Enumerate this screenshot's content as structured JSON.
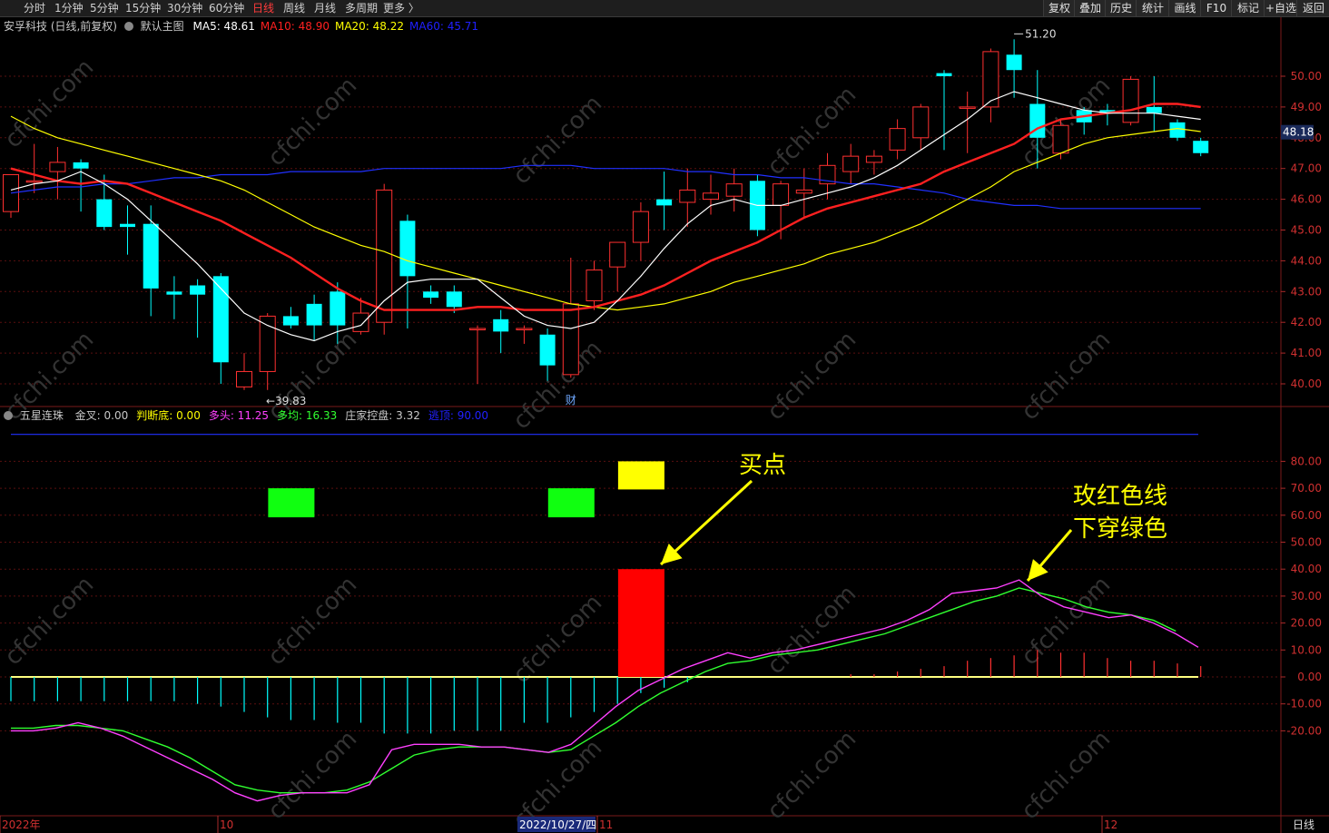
{
  "toolbar": {
    "periods": [
      {
        "label": "分时",
        "active": false
      },
      {
        "label": "1分钟",
        "active": false
      },
      {
        "label": "5分钟",
        "active": false
      },
      {
        "label": "15分钟",
        "active": false
      },
      {
        "label": "30分钟",
        "active": false
      },
      {
        "label": "60分钟",
        "active": false
      },
      {
        "label": "日线",
        "active": true
      },
      {
        "label": "周线",
        "active": false
      },
      {
        "label": "月线",
        "active": false
      },
      {
        "label": "多周期",
        "active": false
      },
      {
        "label": "更多 〉",
        "active": false
      }
    ],
    "right_buttons": [
      "复权",
      "叠加",
      "历史",
      "统计",
      "画线",
      "F10",
      "标记",
      "+自选",
      "返回"
    ]
  },
  "main_panel": {
    "stock_label": "安孚科技 (日线,前复权)",
    "indicator_name": "默认主图",
    "ma": [
      {
        "label": "MA5: 48.61",
        "color": "#ffffff"
      },
      {
        "label": "MA10: 48.90",
        "color": "#ff2020"
      },
      {
        "label": "MA20: 48.22",
        "color": "#ffff00"
      },
      {
        "label": "MA60: 45.71",
        "color": "#2020ff"
      }
    ],
    "high_label": "51.20",
    "low_label": "39.83",
    "current_price": "48.18",
    "event_marker": "财",
    "y_ticks": [
      "50.00",
      "49.00",
      "48.00",
      "47.00",
      "46.00",
      "45.00",
      "44.00",
      "43.00",
      "42.00",
      "41.00",
      "40.00"
    ]
  },
  "sub_panel": {
    "indicator_name": "五星连珠",
    "values": [
      {
        "label": "金叉: 0.00",
        "color": "#c8c8c8"
      },
      {
        "label": "判断底: 0.00",
        "color": "#ffff00"
      },
      {
        "label": "多头: 11.25",
        "color": "#ff40ff"
      },
      {
        "label": "多均: 16.33",
        "color": "#30ff30"
      },
      {
        "label": "庄家控盘: 3.32",
        "color": "#c8c8c8"
      },
      {
        "label": "逃顶: 90.00",
        "color": "#2020ff"
      }
    ],
    "y_ticks": [
      "80.00",
      "70.00",
      "60.00",
      "50.00",
      "40.00",
      "30.00",
      "20.00",
      "10.00",
      "0.00",
      "-10.00",
      "-20.00"
    ]
  },
  "bottom_axis": {
    "labels": [
      "2022年",
      "10",
      "11",
      "12"
    ],
    "cursor_date": "2022/10/27/四",
    "period_label": "日线"
  },
  "annotations": {
    "buy_point": "买点",
    "cross_line1": "玫红色线",
    "cross_line2": "下穿绿色"
  },
  "colors": {
    "up": "#ff3030",
    "down": "#00ffff",
    "ma5": "#ffffff",
    "ma10": "#ff2020",
    "ma20": "#ffff00",
    "ma60": "#2030ff",
    "duotou": "#ff40ff",
    "duojun": "#30ff30",
    "annotation": "#ffff00",
    "watermark": "cfchi.com"
  },
  "chart_data": {
    "type": "candlestick",
    "candles": [
      {
        "o": 45.6,
        "h": 46.8,
        "l": 45.4,
        "c": 46.8
      },
      {
        "o": 46.6,
        "h": 47.8,
        "l": 46.2,
        "c": 46.6
      },
      {
        "o": 46.9,
        "h": 47.7,
        "l": 46.0,
        "c": 47.2
      },
      {
        "o": 47.2,
        "h": 47.3,
        "l": 45.6,
        "c": 47.0
      },
      {
        "o": 46.0,
        "h": 46.8,
        "l": 45.0,
        "c": 45.1
      },
      {
        "o": 45.2,
        "h": 45.8,
        "l": 44.2,
        "c": 45.1
      },
      {
        "o": 45.2,
        "h": 45.8,
        "l": 42.2,
        "c": 43.1
      },
      {
        "o": 43.0,
        "h": 43.5,
        "l": 42.1,
        "c": 42.9
      },
      {
        "o": 43.2,
        "h": 43.4,
        "l": 41.5,
        "c": 42.9
      },
      {
        "o": 43.5,
        "h": 43.6,
        "l": 40.0,
        "c": 40.7
      },
      {
        "o": 39.9,
        "h": 41.0,
        "l": 39.8,
        "c": 40.4
      },
      {
        "o": 40.4,
        "h": 42.3,
        "l": 39.8,
        "c": 42.2
      },
      {
        "o": 42.2,
        "h": 42.5,
        "l": 41.8,
        "c": 41.9
      },
      {
        "o": 42.6,
        "h": 42.9,
        "l": 41.4,
        "c": 41.9
      },
      {
        "o": 43.0,
        "h": 43.3,
        "l": 41.3,
        "c": 41.9
      },
      {
        "o": 41.7,
        "h": 42.8,
        "l": 41.6,
        "c": 42.3
      },
      {
        "o": 42.0,
        "h": 46.5,
        "l": 41.6,
        "c": 46.3
      },
      {
        "o": 45.3,
        "h": 45.5,
        "l": 41.8,
        "c": 43.5
      },
      {
        "o": 43.0,
        "h": 43.2,
        "l": 42.6,
        "c": 42.8
      },
      {
        "o": 43.0,
        "h": 43.2,
        "l": 42.3,
        "c": 42.5
      },
      {
        "o": 41.8,
        "h": 41.9,
        "l": 40.0,
        "c": 41.8
      },
      {
        "o": 42.1,
        "h": 42.4,
        "l": 41.0,
        "c": 41.7
      },
      {
        "o": 41.8,
        "h": 41.9,
        "l": 41.3,
        "c": 41.8
      },
      {
        "o": 41.6,
        "h": 41.8,
        "l": 40.1,
        "c": 40.6
      },
      {
        "o": 40.3,
        "h": 44.1,
        "l": 40.2,
        "c": 42.6
      },
      {
        "o": 42.7,
        "h": 44.0,
        "l": 42.4,
        "c": 43.7
      },
      {
        "o": 43.8,
        "h": 44.6,
        "l": 43.0,
        "c": 44.6
      },
      {
        "o": 44.6,
        "h": 45.9,
        "l": 44.0,
        "c": 45.6
      },
      {
        "o": 46.0,
        "h": 46.9,
        "l": 45.0,
        "c": 45.8
      },
      {
        "o": 45.9,
        "h": 47.0,
        "l": 45.1,
        "c": 46.3
      },
      {
        "o": 46.0,
        "h": 46.8,
        "l": 45.5,
        "c": 46.2
      },
      {
        "o": 46.1,
        "h": 47.0,
        "l": 45.6,
        "c": 46.5
      },
      {
        "o": 46.6,
        "h": 46.8,
        "l": 44.8,
        "c": 45.0
      },
      {
        "o": 45.8,
        "h": 46.6,
        "l": 44.7,
        "c": 46.5
      },
      {
        "o": 46.2,
        "h": 47.0,
        "l": 45.4,
        "c": 46.3
      },
      {
        "o": 46.5,
        "h": 47.5,
        "l": 46.0,
        "c": 47.1
      },
      {
        "o": 46.9,
        "h": 47.8,
        "l": 46.5,
        "c": 47.4
      },
      {
        "o": 47.2,
        "h": 47.6,
        "l": 46.8,
        "c": 47.4
      },
      {
        "o": 47.6,
        "h": 48.6,
        "l": 47.3,
        "c": 48.3
      },
      {
        "o": 48.0,
        "h": 49.1,
        "l": 47.6,
        "c": 49.0
      },
      {
        "o": 50.1,
        "h": 50.2,
        "l": 47.6,
        "c": 50.0
      },
      {
        "o": 49.0,
        "h": 49.5,
        "l": 47.5,
        "c": 49.0
      },
      {
        "o": 49.0,
        "h": 50.9,
        "l": 48.5,
        "c": 50.8
      },
      {
        "o": 50.7,
        "h": 51.2,
        "l": 49.3,
        "c": 50.2
      },
      {
        "o": 49.1,
        "h": 50.2,
        "l": 47.0,
        "c": 48.0
      },
      {
        "o": 47.5,
        "h": 48.6,
        "l": 47.3,
        "c": 48.4
      },
      {
        "o": 48.9,
        "h": 49.0,
        "l": 48.1,
        "c": 48.5
      },
      {
        "o": 48.9,
        "h": 49.1,
        "l": 48.4,
        "c": 48.8
      },
      {
        "o": 48.5,
        "h": 50.0,
        "l": 48.4,
        "c": 49.9
      },
      {
        "o": 49.0,
        "h": 50.0,
        "l": 48.2,
        "c": 48.8
      },
      {
        "o": 48.5,
        "h": 48.6,
        "l": 47.9,
        "c": 48.0
      },
      {
        "o": 47.9,
        "h": 48.0,
        "l": 47.4,
        "c": 47.5
      }
    ],
    "ma5": [
      46.3,
      46.5,
      46.6,
      46.9,
      46.5,
      46.0,
      45.3,
      44.6,
      43.9,
      43.1,
      42.3,
      41.9,
      41.6,
      41.4,
      41.7,
      41.9,
      42.7,
      43.3,
      43.4,
      43.4,
      43.4,
      42.8,
      42.2,
      41.9,
      41.8,
      42.0,
      42.7,
      43.5,
      44.4,
      45.2,
      45.8,
      46.0,
      45.8,
      45.8,
      46.0,
      46.2,
      46.4,
      46.7,
      47.1,
      47.6,
      48.1,
      48.6,
      49.2,
      49.5,
      49.3,
      49.1,
      48.9,
      48.8,
      48.8,
      48.8,
      48.7,
      48.6
    ],
    "ma10": [
      47.0,
      46.8,
      46.6,
      46.5,
      46.6,
      46.5,
      46.2,
      45.9,
      45.6,
      45.3,
      44.9,
      44.5,
      44.1,
      43.6,
      43.1,
      42.7,
      42.4,
      42.4,
      42.4,
      42.4,
      42.5,
      42.5,
      42.4,
      42.4,
      42.4,
      42.5,
      42.7,
      42.9,
      43.2,
      43.6,
      44.0,
      44.3,
      44.6,
      45.0,
      45.4,
      45.7,
      45.9,
      46.1,
      46.3,
      46.5,
      46.9,
      47.2,
      47.5,
      47.8,
      48.3,
      48.6,
      48.7,
      48.8,
      48.9,
      49.1,
      49.1,
      49.0
    ],
    "ma20": [
      48.7,
      48.3,
      48.0,
      47.8,
      47.6,
      47.4,
      47.2,
      47.0,
      46.8,
      46.6,
      46.3,
      45.9,
      45.5,
      45.1,
      44.8,
      44.5,
      44.3,
      44.0,
      43.8,
      43.6,
      43.4,
      43.2,
      43.0,
      42.8,
      42.6,
      42.5,
      42.4,
      42.5,
      42.6,
      42.8,
      43.0,
      43.3,
      43.5,
      43.7,
      43.9,
      44.2,
      44.4,
      44.6,
      44.9,
      45.2,
      45.6,
      46.0,
      46.4,
      46.9,
      47.2,
      47.5,
      47.8,
      48.0,
      48.1,
      48.2,
      48.3,
      48.2
    ],
    "ma60": [
      46.2,
      46.3,
      46.4,
      46.4,
      46.5,
      46.5,
      46.6,
      46.7,
      46.7,
      46.8,
      46.8,
      46.8,
      46.9,
      46.9,
      46.9,
      46.9,
      47.0,
      47.0,
      47.0,
      47.0,
      47.0,
      47.0,
      47.1,
      47.1,
      47.1,
      47.0,
      47.0,
      47.0,
      47.0,
      46.9,
      46.9,
      46.8,
      46.8,
      46.7,
      46.7,
      46.6,
      46.5,
      46.5,
      46.4,
      46.3,
      46.2,
      46.0,
      45.9,
      45.8,
      45.8,
      45.7,
      45.7,
      45.7,
      45.7,
      45.7,
      45.7,
      45.7
    ],
    "sub": {
      "green_markers": [
        12,
        24
      ],
      "yellow_marker": 27,
      "red_bar": {
        "index": 27,
        "from": 0,
        "to": 40
      },
      "topline": 90,
      "hist": [
        -9,
        -9,
        -9,
        -9,
        -9,
        -9,
        -9,
        -9,
        -10,
        -11,
        -13,
        -15,
        -16,
        -16,
        -17,
        -17,
        -21,
        -21,
        -21,
        -20,
        -20,
        -20,
        -17,
        -17,
        -15,
        -13,
        -10,
        -6,
        -4,
        -2,
        0,
        0,
        0,
        0,
        0,
        0,
        1,
        1,
        2,
        3,
        4,
        6,
        7,
        8,
        10,
        9,
        9,
        7,
        6,
        6,
        5,
        4
      ],
      "duotou": [
        -20,
        -20,
        -19,
        -17,
        -19,
        -22,
        -26,
        -30,
        -34,
        -38,
        -43,
        -46,
        -44,
        -43,
        -43,
        -43,
        -40,
        -27,
        -25,
        -25,
        -25,
        -26,
        -26,
        -27,
        -28,
        -25,
        -18,
        -11,
        -5,
        -1,
        3,
        6,
        9,
        7,
        9,
        10,
        12,
        14,
        16,
        18,
        21,
        25,
        31,
        32,
        33,
        36,
        30,
        26,
        24,
        22,
        23,
        20,
        16,
        11
      ],
      "duojun": [
        -19,
        -19,
        -18,
        -18,
        -19,
        -20,
        -23,
        -26,
        -30,
        -35,
        -40,
        -42,
        -43,
        -43,
        -43,
        -42,
        -39,
        -34,
        -29,
        -27,
        -26,
        -26,
        -26,
        -27,
        -28,
        -27,
        -22,
        -17,
        -11,
        -6,
        -2,
        2,
        5,
        6,
        8,
        9,
        10,
        12,
        14,
        16,
        19,
        22,
        25,
        28,
        30,
        33,
        31,
        29,
        26,
        24,
        23,
        21,
        17
      ]
    }
  }
}
